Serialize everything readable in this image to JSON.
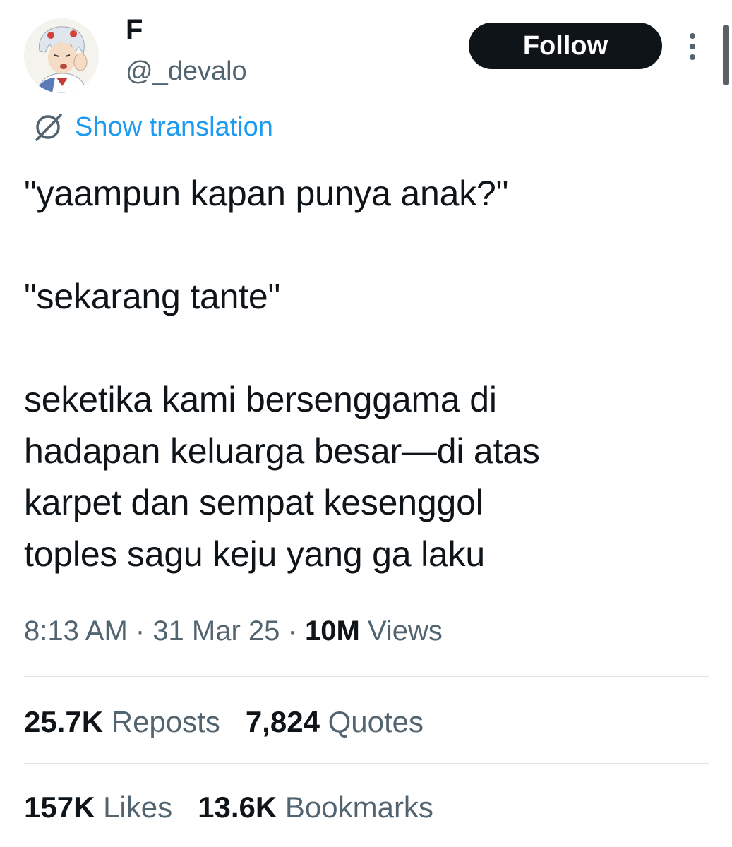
{
  "author": {
    "display_name": "F",
    "handle": "@_devalo",
    "avatar_icon": "anime-avatar"
  },
  "follow_label": "Follow",
  "more_icon": "more-vertical-icon",
  "translation": {
    "icon": "globe-translate-icon",
    "label": "Show translation"
  },
  "tweet": {
    "text": "\"yaampun kapan punya anak?\"\n\n\"sekarang tante\"\n\nseketika kami bersenggama di\nhadapan keluarga besar—di atas\nkarpet dan sempat kesenggol\ntoples sagu keju yang ga laku"
  },
  "meta": {
    "time": "8:13 AM",
    "sep1": " · ",
    "date": "31 Mar 25",
    "sep2": " · ",
    "views_count": "10M",
    "views_label": " Views"
  },
  "stats": {
    "reposts": {
      "count": "25.7K",
      "label": " Reposts"
    },
    "quotes": {
      "count": "7,824",
      "label": " Quotes"
    },
    "likes": {
      "count": "157K",
      "label": " Likes"
    },
    "bookmarks": {
      "count": "13.6K",
      "label": " Bookmarks"
    }
  },
  "colors": {
    "accent": "#1d9bf0",
    "text": "#0f1419",
    "secondary": "#536471",
    "button": "#0f1419"
  }
}
